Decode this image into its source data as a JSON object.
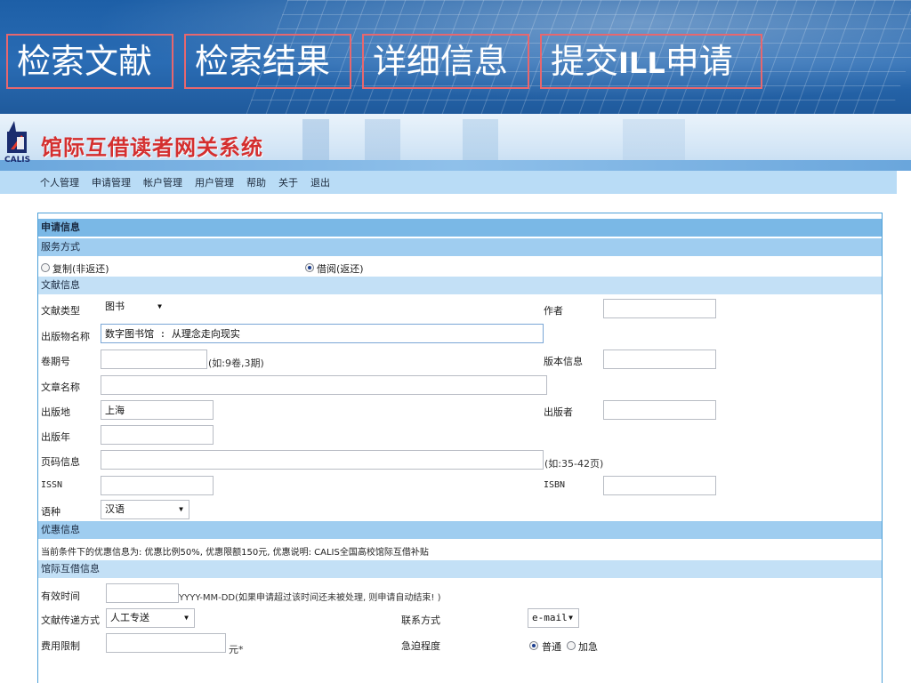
{
  "banner": {
    "tabs": [
      "检索文献",
      "检索结果",
      "详细信息",
      "提交",
      "ILL",
      "申请"
    ]
  },
  "app": {
    "logo_text": "CALIS",
    "title": "馆际互借读者网关系统"
  },
  "nav": {
    "items": [
      "个人管理",
      "申请管理",
      "帐户管理",
      "用户管理",
      "帮助",
      "关于",
      "退出"
    ]
  },
  "form": {
    "section_request": "申请信息",
    "section_service": "服务方式",
    "service_copy": "复制(非返还)",
    "service_loan": "借阅(返还)",
    "service_selected": "借阅(返还)",
    "section_doc": "文献信息",
    "doc_type_label": "文献类型",
    "doc_type_value": "图书",
    "author_label": "作者",
    "author_value": "",
    "pub_title_label": "出版物名称",
    "pub_title_value": "数字图书馆 : 从理念走向现实",
    "volume_label": "卷期号",
    "volume_value": "",
    "volume_hint": "(如:9卷,3期)",
    "edition_label": "版本信息",
    "edition_value": "",
    "article_label": "文章名称",
    "article_value": "",
    "place_label": "出版地",
    "place_value": "上海",
    "publisher_label": "出版者",
    "publisher_value": "",
    "year_label": "出版年",
    "year_value": "",
    "pages_label": "页码信息",
    "pages_value": "",
    "pages_hint": "(如:35-42页)",
    "issn_label": "ISSN",
    "issn_value": "",
    "isbn_label": "ISBN",
    "isbn_value": "",
    "language_label": "语种",
    "language_value": "汉语",
    "section_discount": "优惠信息",
    "discount_text": "当前条件下的优惠信息为: 优惠比例50%, 优惠限额150元, 优惠说明: CALIS全国高校馆际互借补贴",
    "section_ill": "馆际互借信息",
    "valid_label": "有效时间",
    "valid_value": "",
    "valid_hint": "YYYY-MM-DD(如果申请超过该时间还未被处理, 则申请自动结束! )",
    "delivery_label": "文献传递方式",
    "delivery_value": "人工专送",
    "contact_label": "联系方式",
    "contact_value": "e-mail",
    "fee_label": "费用限制",
    "fee_value": "",
    "fee_unit": "元*",
    "urgency_label": "急迫程度",
    "urgency_normal": "普通",
    "urgency_urgent": "加急",
    "urgency_selected": "普通"
  },
  "colors": {
    "banner_blue": "#1d5fa7",
    "tab_border": "#e7676e",
    "title_red": "#d42f2f",
    "nav_bg": "#b9dcf6",
    "section_bg": "#9fcdf0",
    "panel_border": "#4da0d8"
  }
}
